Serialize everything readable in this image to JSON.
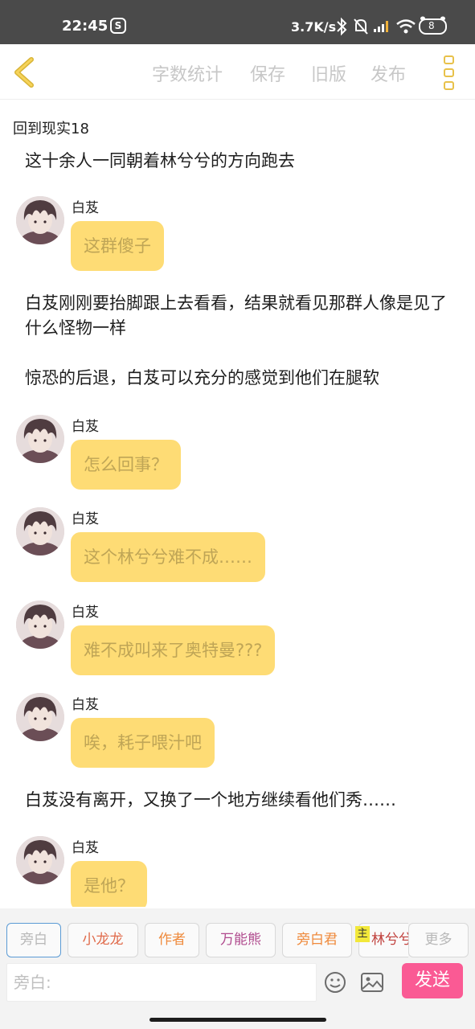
{
  "status_bar": {
    "time": "22:45",
    "app_badge": "S",
    "net_speed": "3.7K/s",
    "battery_level": "8",
    "icons": [
      "bluetooth-icon",
      "mute-bell-icon",
      "signal-icon",
      "wifi-icon",
      "battery-icon"
    ]
  },
  "top_bar": {
    "menu": [
      "字数统计",
      "保存",
      "旧版",
      "发布"
    ]
  },
  "chapter_title": "回到现实18",
  "feed": [
    {
      "type": "narration",
      "text": "这十余人一同朝着林兮兮的方向跑去"
    },
    {
      "type": "chat",
      "name": "白芨",
      "text": "这群傻子"
    },
    {
      "type": "narration",
      "text": "白芨刚刚要抬脚跟上去看看，结果就看见那群人像是见了什么怪物一样"
    },
    {
      "type": "narration",
      "text": "惊恐的后退，白芨可以充分的感觉到他们在腿软"
    },
    {
      "type": "chat",
      "name": "白芨",
      "text": "怎么回事？"
    },
    {
      "type": "chat",
      "name": "白芨",
      "text": "这个林兮兮难不成……"
    },
    {
      "type": "chat",
      "name": "白芨",
      "text": "难不成叫来了奥特曼???"
    },
    {
      "type": "chat",
      "name": "白芨",
      "text": "唉，耗子喂汁吧"
    },
    {
      "type": "narration",
      "text": "白芨没有离开，又换了一个地方继续看他们秀……"
    },
    {
      "type": "chat",
      "name": "白芨",
      "text": "是他？"
    }
  ],
  "roles": [
    {
      "label": "旁白",
      "color": "#b8b8b8",
      "selected": true
    },
    {
      "label": "小龙龙",
      "color": "#e06a4a",
      "selected": false
    },
    {
      "label": "作者",
      "color": "#ef8a3c",
      "selected": false
    },
    {
      "label": "万能熊",
      "color": "#b04b8e",
      "selected": false
    },
    {
      "label": "旁白君",
      "color": "#ef8a3c",
      "selected": false
    },
    {
      "label": "林兮兮",
      "color": "#c0403c",
      "selected": false
    },
    {
      "label": "更多",
      "color": "#b8b8b8",
      "selected": false
    }
  ],
  "host_mark": "主",
  "input": {
    "placeholder": "旁白:",
    "send_label": "发送"
  },
  "colors": {
    "bubble": "#fedc75",
    "bubble_text": "#bfa556",
    "send": "#fa5a94",
    "accent": "#e8c14a"
  }
}
